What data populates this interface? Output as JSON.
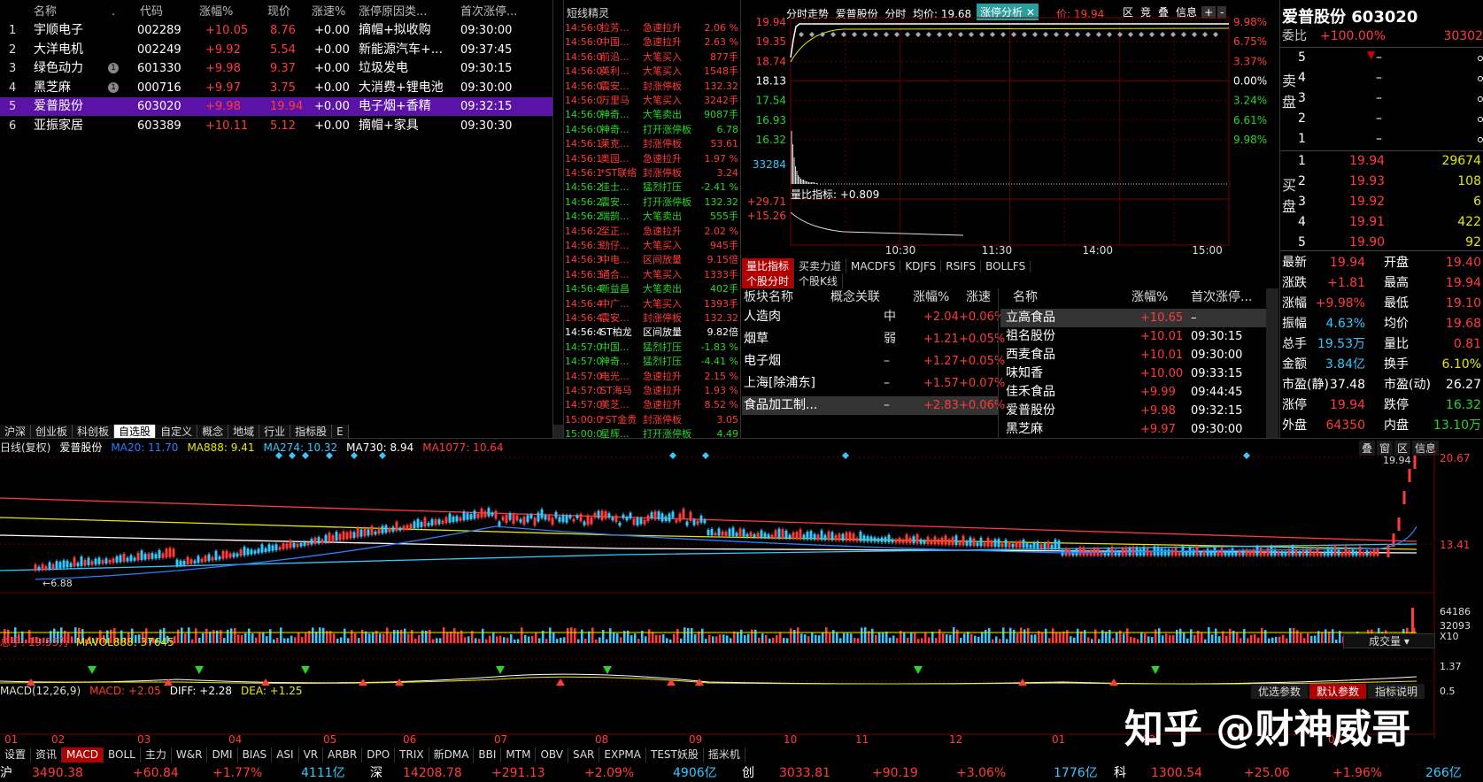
{
  "watchlist": {
    "headers": [
      "名称",
      ".",
      "代码",
      "涨幅%",
      "现价",
      "涨速%",
      "涨停原因类...",
      "首次涨停..."
    ],
    "rows": [
      {
        "no": "1",
        "name": "宇顺电子",
        "mark": "",
        "code": "002289",
        "pct": "+10.05",
        "price": "8.76",
        "speed": "+0.00",
        "reason": "摘帽+拟收购",
        "time": "09:30:00"
      },
      {
        "no": "2",
        "name": "大洋电机",
        "mark": "",
        "code": "002249",
        "pct": "+9.92",
        "price": "5.54",
        "speed": "+0.00",
        "reason": "新能源汽车+...",
        "time": "09:37:45"
      },
      {
        "no": "3",
        "name": "绿色动力",
        "mark": "1",
        "code": "601330",
        "pct": "+9.98",
        "price": "9.37",
        "speed": "+0.00",
        "reason": "垃圾发电",
        "time": "09:30:15"
      },
      {
        "no": "4",
        "name": "黑芝麻",
        "mark": "1",
        "code": "000716",
        "pct": "+9.97",
        "price": "3.75",
        "speed": "+0.00",
        "reason": "大消费+锂电池",
        "time": "09:30:00"
      },
      {
        "no": "5",
        "name": "爱普股份",
        "mark": "",
        "code": "603020",
        "pct": "+9.98",
        "price": "19.94",
        "speed": "+0.00",
        "reason": "电子烟+香精",
        "time": "09:32:15"
      },
      {
        "no": "6",
        "name": "亚振家居",
        "mark": "",
        "code": "603389",
        "pct": "+10.11",
        "price": "5.12",
        "speed": "+0.00",
        "reason": "摘帽+家具",
        "time": "09:30:30"
      }
    ],
    "tabs": [
      "沪深",
      "创业板",
      "科创板",
      "自选股",
      "自定义",
      "概念",
      "地域",
      "行业",
      "指标股",
      "E"
    ]
  },
  "short_title": "短线精灵",
  "short_list": [
    {
      "t": "14:56:0",
      "n": "拉芳...",
      "e": "急速拉升",
      "v": "2.06 %",
      "c": "red"
    },
    {
      "t": "14:56:0",
      "n": "中国...",
      "e": "急速拉升",
      "v": "2.63 %",
      "c": "red"
    },
    {
      "t": "14:56:0",
      "n": "前沿...",
      "e": "大笔买入",
      "v": "877手",
      "c": "red"
    },
    {
      "t": "14:56:0",
      "n": "英利...",
      "e": "大笔买入",
      "v": "1548手",
      "c": "red"
    },
    {
      "t": "14:56:0",
      "n": "震安...",
      "e": "封涨停板",
      "v": "132.32",
      "c": "red"
    },
    {
      "t": "14:56:0",
      "n": "万里马",
      "e": "大笔买入",
      "v": "3242手",
      "c": "red"
    },
    {
      "t": "14:56:0",
      "n": "神奇...",
      "e": "大笔卖出",
      "v": "9087手",
      "c": "grn"
    },
    {
      "t": "14:56:0",
      "n": "神奇...",
      "e": "打开涨停板",
      "v": "6.78",
      "c": "grn"
    },
    {
      "t": "14:56:1",
      "n": "莱克...",
      "e": "封涨停板",
      "v": "53.61",
      "c": "red"
    },
    {
      "t": "14:56:1",
      "n": "奥园...",
      "e": "急速拉升",
      "v": "1.97 %",
      "c": "red"
    },
    {
      "t": "14:56:1",
      "n": "*ST联络",
      "e": "封涨停板",
      "v": "3.24",
      "c": "red"
    },
    {
      "t": "14:56:2",
      "n": "佳士...",
      "e": "猛烈打压",
      "v": "-2.41 %",
      "c": "grn"
    },
    {
      "t": "14:56:2",
      "n": "震安...",
      "e": "打开涨停板",
      "v": "132.32",
      "c": "grn"
    },
    {
      "t": "14:56:2",
      "n": "瑞鹄...",
      "e": "大笔卖出",
      "v": "555手",
      "c": "grn"
    },
    {
      "t": "14:56:2",
      "n": "至正...",
      "e": "急速拉升",
      "v": "2.02 %",
      "c": "red"
    },
    {
      "t": "14:56:3",
      "n": "劲仔...",
      "e": "大笔买入",
      "v": "945手",
      "c": "red"
    },
    {
      "t": "14:56:3",
      "n": "中电...",
      "e": "区间放量",
      "v": "9.15倍",
      "c": "red"
    },
    {
      "t": "14:56:3",
      "n": "通合...",
      "e": "大笔买入",
      "v": "1333手",
      "c": "red"
    },
    {
      "t": "14:56:4",
      "n": "新益昌",
      "e": "大笔卖出",
      "v": "402手",
      "c": "grn"
    },
    {
      "t": "14:56:4",
      "n": "中广...",
      "e": "大笔买入",
      "v": "1393手",
      "c": "red"
    },
    {
      "t": "14:56:4",
      "n": "震安...",
      "e": "封涨停板",
      "v": "132.32",
      "c": "red"
    },
    {
      "t": "14:56:4",
      "n": "ST柏龙",
      "e": "区间放量",
      "v": "9.82倍",
      "c": "wht"
    },
    {
      "t": "14:57:0",
      "n": "中国...",
      "e": "猛烈打压",
      "v": "-1.83 %",
      "c": "grn"
    },
    {
      "t": "14:57:0",
      "n": "神奇...",
      "e": "猛烈打压",
      "v": "-4.41 %",
      "c": "grn"
    },
    {
      "t": "14:57:0",
      "n": "电光...",
      "e": "急速拉升",
      "v": "2.15 %",
      "c": "red"
    },
    {
      "t": "14:57:0",
      "n": "ST海马",
      "e": "急速拉升",
      "v": "1.93 %",
      "c": "red"
    },
    {
      "t": "14:57:0",
      "n": "美芝...",
      "e": "急速拉升",
      "v": "8.52 %",
      "c": "red"
    },
    {
      "t": "15:00:0",
      "n": "*ST金贵",
      "e": "封涨停板",
      "v": "3.05",
      "c": "red"
    },
    {
      "t": "15:00:0",
      "n": "星辉...",
      "e": "打开涨停板",
      "v": "4.49",
      "c": "grn"
    }
  ],
  "intraday": {
    "header": [
      "分时走势",
      "爱普股份",
      "分时",
      "均价: 19.68",
      "涨停分析",
      "价: 19.94"
    ],
    "btns": [
      "区",
      "竞",
      "叠",
      "信息",
      "+",
      "-"
    ],
    "left_prices": [
      "19.94",
      "19.35",
      "18.74",
      "18.13",
      "17.54",
      "16.93",
      "16.32"
    ],
    "right_pcts": [
      "9.98%",
      "6.75%",
      "3.37%",
      "0.00%",
      "3.24%",
      "6.61%",
      "9.98%"
    ],
    "vol_label": "33284",
    "ind_label": "量比指标: +0.809",
    "ind_top": "+29.71",
    "ind_mid": "+15.26",
    "times": [
      "10:30",
      "11:30",
      "14:00",
      "15:00"
    ],
    "ind_tabs": [
      "量比指标",
      "买卖力道",
      "MACDFS",
      "KDJFS",
      "RSIFS",
      "BOLLFS"
    ],
    "ind_tabs2": [
      "个股分时",
      "个股K线"
    ]
  },
  "sectors": {
    "headers": [
      "板块名称",
      "概念关联",
      "涨幅%",
      "涨速"
    ],
    "rows": [
      {
        "n": "人造肉",
        "r": "中",
        "p": "+2.04",
        "s": "+0.06%"
      },
      {
        "n": "烟草",
        "r": "弱",
        "p": "+1.21",
        "s": "+0.05%"
      },
      {
        "n": "电子烟",
        "r": "–",
        "p": "+1.27",
        "s": "+0.05%"
      },
      {
        "n": "上海[除浦东]",
        "r": "–",
        "p": "+1.57",
        "s": "+0.07%"
      },
      {
        "n": "食品加工制...",
        "r": "–",
        "p": "+2.83",
        "s": "+0.06%"
      }
    ]
  },
  "related": {
    "headers": [
      "名称",
      "涨幅%",
      "首次涨停..."
    ],
    "rows": [
      {
        "n": "立高食品",
        "p": "+10.65",
        "t": "–"
      },
      {
        "n": "祖名股份",
        "p": "+10.01",
        "t": "09:30:15"
      },
      {
        "n": "西麦食品",
        "p": "+10.01",
        "t": "09:30:00"
      },
      {
        "n": "味知香",
        "p": "+10.00",
        "t": "09:33:15"
      },
      {
        "n": "佳禾食品",
        "p": "+9.99",
        "t": "09:44:45"
      },
      {
        "n": "爱普股份",
        "p": "+9.98",
        "t": "09:32:15"
      },
      {
        "n": "黑芝麻",
        "p": "+9.97",
        "t": "09:30:00"
      }
    ]
  },
  "quote": {
    "title": "爱普股份 603020",
    "weibi_label": "委比",
    "weibi": "+100.00%",
    "weicha": "30302",
    "sell_label": "卖盘",
    "buy_label": "买盘",
    "sells": [
      {
        "lv": "5",
        "p": "–",
        "v": ""
      },
      {
        "lv": "4",
        "p": "–",
        "v": ""
      },
      {
        "lv": "3",
        "p": "–",
        "v": ""
      },
      {
        "lv": "2",
        "p": "–",
        "v": ""
      },
      {
        "lv": "1",
        "p": "–",
        "v": ""
      }
    ],
    "buys": [
      {
        "lv": "1",
        "p": "19.94",
        "v": "29674"
      },
      {
        "lv": "2",
        "p": "19.93",
        "v": "108"
      },
      {
        "lv": "3",
        "p": "19.92",
        "v": "6"
      },
      {
        "lv": "4",
        "p": "19.91",
        "v": "422"
      },
      {
        "lv": "5",
        "p": "19.90",
        "v": "92"
      }
    ],
    "stats": [
      {
        "l1": "最新",
        "v1": "19.94",
        "l2": "开盘",
        "v2": "19.40"
      },
      {
        "l1": "涨跌",
        "v1": "+1.81",
        "l2": "最高",
        "v2": "19.94"
      },
      {
        "l1": "涨幅",
        "v1": "+9.98%",
        "l2": "最低",
        "v2": "19.10"
      },
      {
        "l1": "振幅",
        "v1": "4.63%",
        "l2": "均价",
        "v2": "19.68"
      },
      {
        "l1": "总手",
        "v1": "19.53万",
        "l2": "量比",
        "v2": "0.81"
      },
      {
        "l1": "金额",
        "v1": "3.84亿",
        "l2": "换手",
        "v2": "6.10%"
      },
      {
        "l1": "市盈(静)",
        "v1": "37.48",
        "l2": "市盈(动)",
        "v2": "26.27"
      },
      {
        "l1": "涨停",
        "v1": "19.94",
        "l2": "跌停",
        "v2": "16.32"
      },
      {
        "l1": "外盘",
        "v1": "64350",
        "l2": "内盘",
        "v2": "13.10万"
      }
    ]
  },
  "kline": {
    "legend": [
      {
        "t": "日线(复权)",
        "c": "#ddd"
      },
      {
        "t": "爱普股份",
        "c": "#fff"
      },
      {
        "t": "MA20: 11.70",
        "c": "#2a7fff"
      },
      {
        "t": "MA888: 9.41",
        "c": "#e8e800"
      },
      {
        "t": "MA274: 10.32",
        "c": "#34c8ff"
      },
      {
        "t": "MA730: 8.94",
        "c": "#fff"
      },
      {
        "t": "MA1077: 10.64",
        "c": "#ff3b3b"
      }
    ],
    "top_btns": [
      "叠",
      "窗",
      "区",
      "信息"
    ],
    "price_top": "20.67",
    "price_mid": "13.41",
    "high_label": "19.94",
    "low_label": "6.88",
    "vol_legend": "总手: 19.53万",
    "mavol": "MAVOL888: 37645",
    "vol_select": "成交量",
    "vol_scale": [
      "64186",
      "32093",
      "X10"
    ],
    "macd_legend": [
      {
        "t": "MACD(12,26,9)",
        "c": "#ddd"
      },
      {
        "t": "MACD: +2.05",
        "c": "#ff3b3b"
      },
      {
        "t": "DIFF: +2.28",
        "c": "#fff"
      },
      {
        "t": "DEA: +1.25",
        "c": "#e8e800"
      }
    ],
    "macd_btns": [
      "优选参数",
      "默认参数",
      "指标说明"
    ],
    "macd_scale": [
      "1.37",
      "0.5"
    ],
    "months": [
      "01",
      "02",
      "03",
      "04",
      "05",
      "06",
      "07",
      "08",
      "09",
      "10",
      "11",
      "12",
      "01",
      "02",
      "03"
    ]
  },
  "watermark": "知乎 @财神威哥",
  "bottom_tabs": [
    "设置",
    "资讯",
    "MACD",
    "BOLL",
    "主力",
    "W&R",
    "DMI",
    "BIAS",
    "ASI",
    "VR",
    "ARBR",
    "DPO",
    "TRIX",
    "新DMA",
    "BBI",
    "MTM",
    "OBV",
    "SAR",
    "EXPMA",
    "TEST妖股",
    "摇米机"
  ],
  "status": {
    "sh_label": "沪",
    "sh": "3490.38",
    "sh_chg": "+60.84",
    "sh_pct": "+1.77%",
    "sh_amt": "4111亿",
    "sz_label": "深",
    "sz": "14208.78",
    "sz_chg": "+291.13",
    "sz_pct": "+2.09%",
    "sz_amt": "4906亿",
    "cy_label": "创",
    "cy": "3033.81",
    "cy_chg": "+90.19",
    "cy_pct": "+3.06%",
    "cy_amt": "1776亿",
    "kc_label": "科",
    "kc": "1300.54",
    "kc_chg": "+25.06",
    "kc_pct": "+1.96%",
    "kc_amt": "266亿"
  }
}
